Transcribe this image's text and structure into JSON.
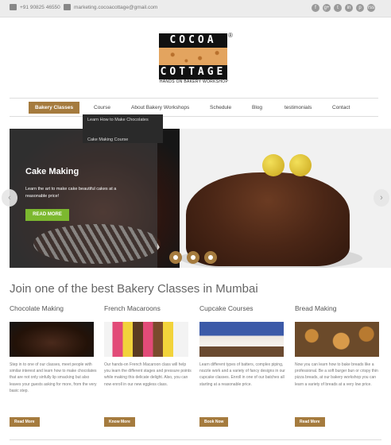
{
  "topbar": {
    "phone": "+91 90825 46550",
    "email": "marketing.cocoacottage@gmail.com",
    "phone_icon": "phone-icon",
    "email_icon": "envelope-icon",
    "social": [
      "f",
      "g+",
      "t",
      "in",
      "p",
      "rss"
    ]
  },
  "logo": {
    "line1": "COCOA",
    "line2": "COTTAGE",
    "registered": "®",
    "tagline": "HANDS ON BAKERY WORKSHOP"
  },
  "nav": {
    "items": [
      "Bakery Classes",
      "Course",
      "About Bakery Workshops",
      "Schedule",
      "Blog",
      "testimonials",
      "Contact"
    ],
    "dropdown": [
      "Learn How to Make Chocolates",
      "Cake Making Course"
    ]
  },
  "slider": {
    "title": "Cake Making",
    "text": "Learn the art to make cake beautiful cakes at a reasonable price!",
    "button": "READ MORE",
    "prev": "‹",
    "next": "›",
    "slide_count": 3
  },
  "section": {
    "headline": "Join one of the best Bakery Classes in Mumbai",
    "columns": [
      {
        "title": "Chocolate Making",
        "text": "Step in to one of our classes, meet people with similar interest and learn how to make chocolates that are not only sinfully lip smacking but also leaves your guests asking for more, from the very basic step.",
        "button": "Read More"
      },
      {
        "title": "French Macaroons",
        "text": "Our hands-on French Macaroon class will help you learn the different stages and pressure points while making this delicate delight. Also, you can now enroll in our new eggless class.",
        "button": "Know More"
      },
      {
        "title": "Cupcake Courses",
        "text": "Learn different types of batters, complex piping, nozzle work and a variety of fancy designs in our cupcake classes. Enroll in one of our batches all starting at a reasonable price.",
        "button": "Book Now"
      },
      {
        "title": "Bread Making",
        "text": "Now you can learn how to bake breads like a professional. Be a soft burger bun or crispy thin pizza breads, at our bakery workshop you can learn a variety of breads at a very low price.",
        "button": "Read More"
      }
    ]
  },
  "colors": {
    "accent": "#a57b3e",
    "green": "#7cb82f",
    "topbar": "#ececec"
  }
}
